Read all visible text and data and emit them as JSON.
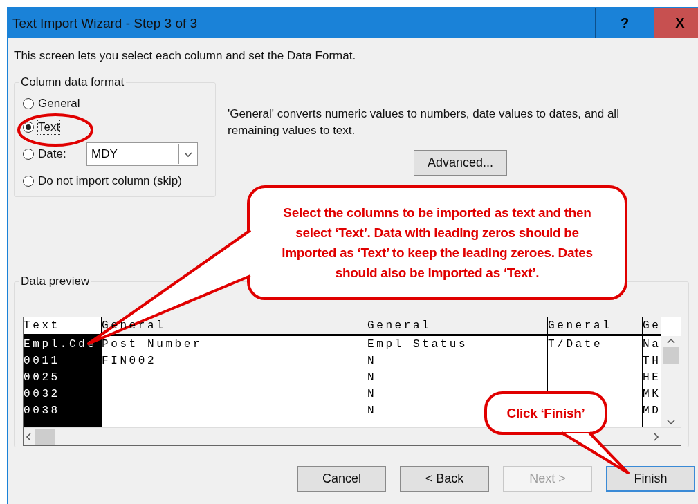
{
  "window": {
    "title": "Text Import Wizard - Step 3 of 3",
    "buttons": [
      "?",
      "X"
    ]
  },
  "description": "This screen lets you select each column and set the Data Format.",
  "column_data_format": {
    "label": "Column data format",
    "options": [
      {
        "kind": "plain",
        "label": "General",
        "selected": false
      },
      {
        "kind": "plain",
        "label": "Text",
        "selected": true
      },
      {
        "kind": "date",
        "label": "Date:",
        "selected": false,
        "value": "MDY"
      },
      {
        "kind": "plain",
        "label": "Do not import column (skip)",
        "selected": false
      }
    ]
  },
  "hint": "'General' converts numeric values to numbers, date values to dates, and all remaining values to text.",
  "advanced_button": "Advanced...",
  "data_preview": {
    "label": "Data preview",
    "columns": [
      {
        "format": "Text",
        "selected": true,
        "cells": [
          "Empl.Cde",
          "0011",
          "0025",
          "0032",
          "0038"
        ]
      },
      {
        "format": "General",
        "selected": false,
        "cells": [
          "Post Number",
          "FIN002",
          "",
          "",
          ""
        ]
      },
      {
        "format": "General",
        "selected": false,
        "cells": [
          "Empl Status",
          "N",
          "N",
          "N",
          "N"
        ]
      },
      {
        "format": "General",
        "selected": false,
        "cells": [
          "T/Date",
          "",
          "",
          "",
          ""
        ]
      },
      {
        "format": "Ge",
        "selected": false,
        "cells": [
          "Na",
          "TH",
          "HE",
          "MK",
          "MD"
        ]
      }
    ]
  },
  "buttons": [
    {
      "label": "Cancel",
      "disabled": false,
      "default": false
    },
    {
      "label": "< Back",
      "disabled": false,
      "default": false
    },
    {
      "label": "Next >",
      "disabled": true,
      "default": false
    },
    {
      "label": "Finish",
      "disabled": false,
      "default": true
    }
  ],
  "callouts": [
    {
      "text": "Select the columns to be imported as text and then select ‘Text’. Data with leading zeros should be imported as ‘Text’ to keep the leading zeroes. Dates should also be imported as ‘Text’."
    },
    {
      "text": "Click ‘Finish’"
    }
  ]
}
